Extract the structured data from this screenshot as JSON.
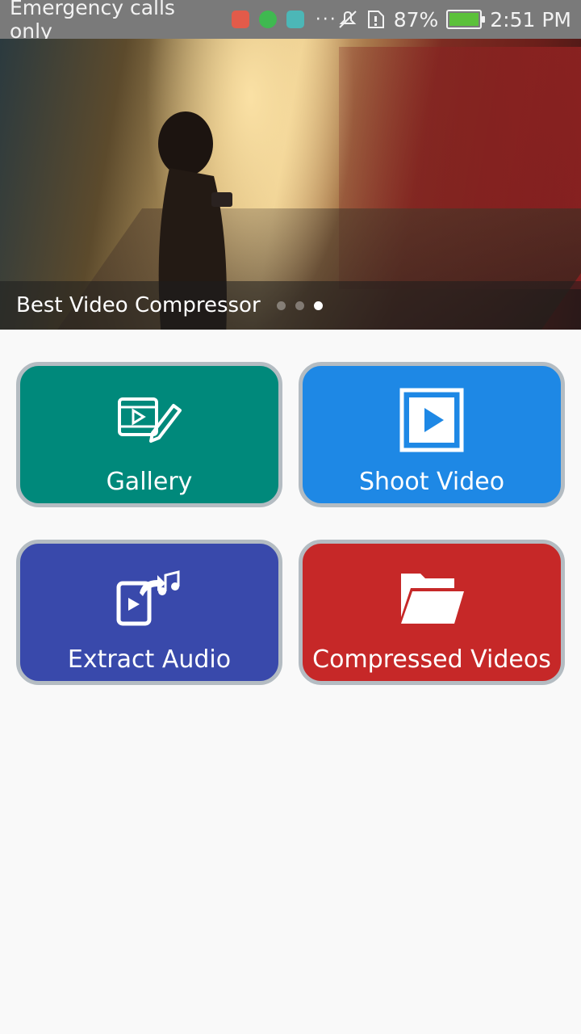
{
  "status_bar": {
    "carrier_text": "Emergency calls only",
    "battery_percent": "87%",
    "time": "2:51 PM",
    "notification_icons": [
      "mail-icon",
      "globe-icon",
      "android-icon"
    ],
    "overflow": "···"
  },
  "banner": {
    "caption": "Best Video Compressor",
    "pages": 3,
    "active_page": 3
  },
  "tiles": [
    {
      "label": "Gallery",
      "icon": "video-edit-icon",
      "color": "#00897b"
    },
    {
      "label": "Shoot Video",
      "icon": "play-square-icon",
      "color": "#1e88e5"
    },
    {
      "label": "Extract Audio",
      "icon": "video-to-audio-icon",
      "color": "#3949ab"
    },
    {
      "label": "Compressed Videos",
      "icon": "folder-icon",
      "color": "#c62828"
    }
  ]
}
